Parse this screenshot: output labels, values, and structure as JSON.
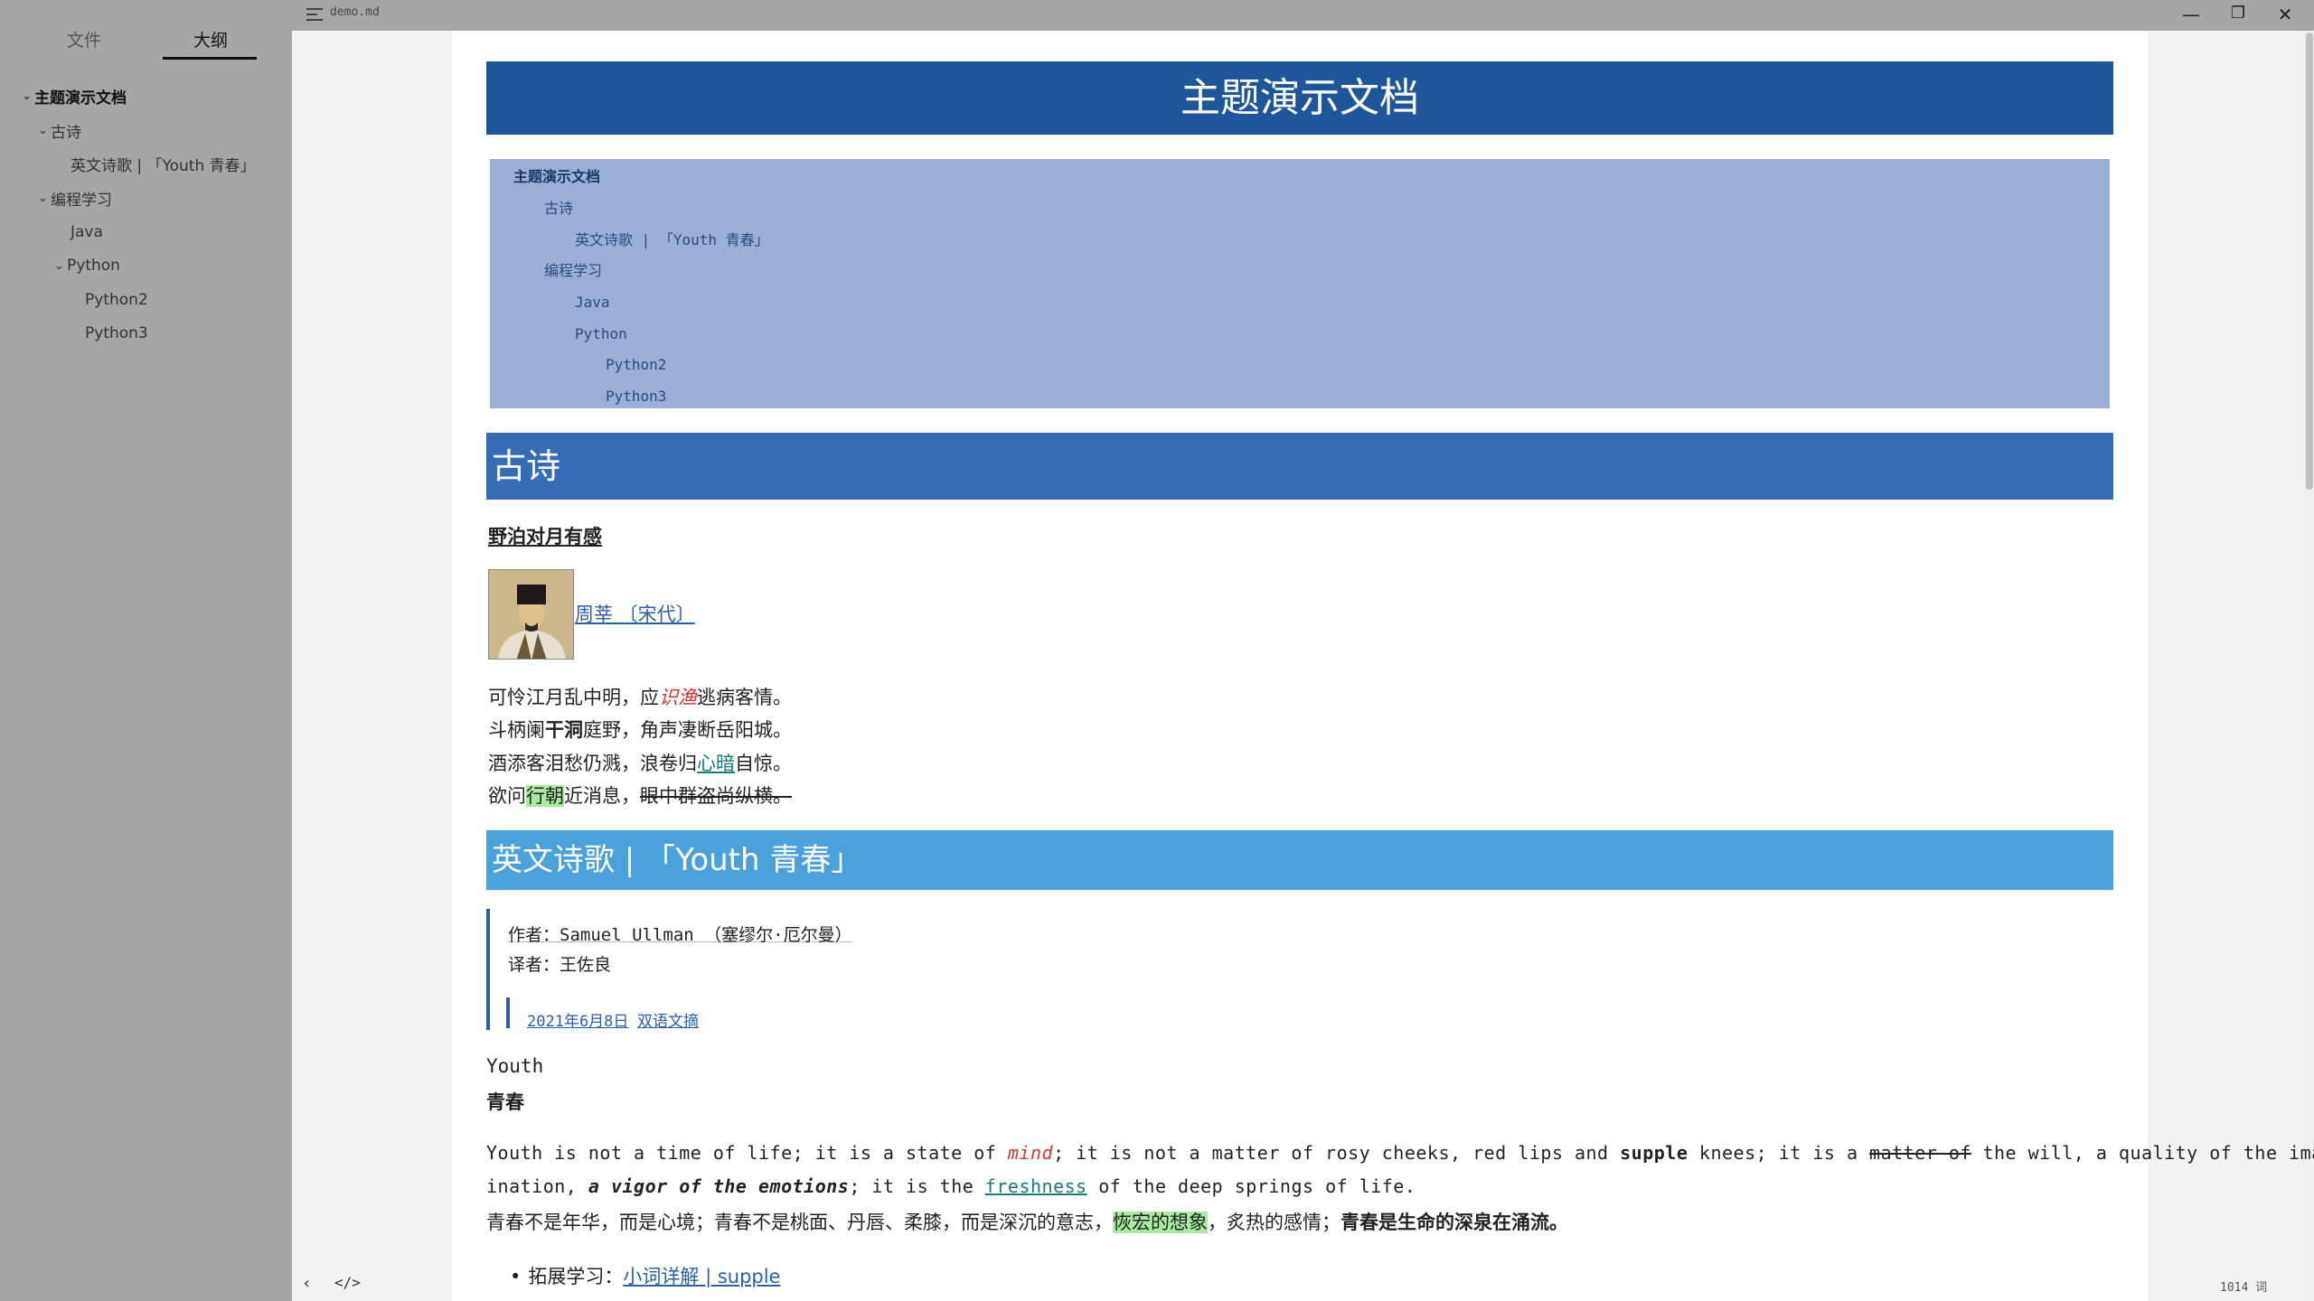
{
  "window": {
    "filename": "demo.md",
    "minimize": "—",
    "restore": "❐",
    "close": "✕"
  },
  "sidebar": {
    "tabs": [
      "文件",
      "大纲"
    ],
    "tree": [
      {
        "label": "主题演示文档",
        "level": 0,
        "chevron": "v"
      },
      {
        "label": "古诗",
        "level": 1,
        "chevron": "v"
      },
      {
        "label": "英文诗歌 | 「Youth 青春」",
        "level": 2,
        "chevron": ""
      },
      {
        "label": "编程学习",
        "level": 1,
        "chevron": "v"
      },
      {
        "label": "Java",
        "level": 2,
        "chevron": ""
      },
      {
        "label": "Python",
        "level": 2,
        "chevron": "v"
      },
      {
        "label": "Python2",
        "level": 3,
        "chevron": ""
      },
      {
        "label": "Python3",
        "level": 3,
        "chevron": ""
      }
    ]
  },
  "doc": {
    "title": "主题演示文档",
    "toc": [
      "主题演示文档",
      "古诗",
      "英文诗歌 | 「Youth 青春」",
      "编程学习",
      "Java",
      "Python",
      "Python2",
      "Python3"
    ],
    "h2_gushi": "古诗",
    "poem_title": "野泊对月有感",
    "author_link": "周莘 〔宋代〕",
    "poem": {
      "l1_a": "可怜江月乱中明，应",
      "l1_b": "识渔",
      "l1_c": "逃病客情。",
      "l2_a": "斗柄阑",
      "l2_b": "干洞",
      "l2_c": "庭野，角声凄断岳阳城。",
      "l3_a": "酒添客泪愁仍溅，浪卷归",
      "l3_b": "心暗",
      "l3_c": "自惊。",
      "l4_a": "欲问",
      "l4_b": "行朝",
      "l4_c": "近消息，",
      "l4_d": "眼中群盗尚纵横。"
    },
    "h2_youth": "英文诗歌 | 「Youth 青春」",
    "quote": {
      "author": "作者：Samuel Ullman （塞缪尔·厄尔曼）",
      "translator": "译者：王佐良",
      "date_link": "2021年6月8日",
      "tag_link": "双语文摘"
    },
    "youth_title": "Youth",
    "youth_cn_title": "青春",
    "para1": {
      "a": "Youth is not a time of life; it is a state of ",
      "mind": "mind",
      "b": "; it is not a matter of rosy cheeks, red lips and ",
      "supple": "supple",
      "c": " knees; it is a ",
      "strike": "matter of",
      "d": " the will, a quality of the imag"
    },
    "para2": {
      "a": "ination, ",
      "bold_italic": "a vigor of the emotions",
      "b": "; it is the ",
      "freshness": "freshness",
      "c": " of the deep springs of life."
    },
    "para_cn": {
      "a": "青春不是年华，而是心境；青春不是桃面、丹唇、柔膝，而是深沉的意志，",
      "hl": "恢宏的想象",
      "b": "，炙热的感情；",
      "bold": "青春是生命的深泉在涌流。"
    },
    "bullet_label": "拓展学习：",
    "bullet_link": "小词详解 | supple"
  },
  "status": {
    "outline_toggle": "‹",
    "source_toggle": "</>",
    "word_count": "1014 词"
  }
}
